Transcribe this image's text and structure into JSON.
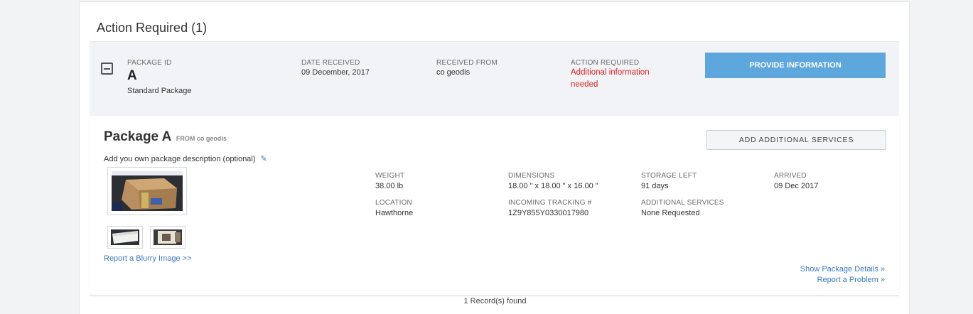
{
  "section": {
    "title": "Action Required (1)"
  },
  "summary": {
    "package_id_label": "PACKAGE ID",
    "package_id": "A",
    "package_type": "Standard Package",
    "date_received_label": "DATE RECEIVED",
    "date_received": "09 December, 2017",
    "received_from_label": "RECEIVED FROM",
    "received_from": "co geodis",
    "action_required_label": "ACTION REQUIRED",
    "action_required": "Additional information needed",
    "provide_button": "PROVIDE INFORMATION",
    "collapse_icon": "minus-square-icon"
  },
  "package": {
    "name": "Package A",
    "from_text": "FROM co geodis",
    "add_services_button": "ADD ADDITIONAL SERVICES",
    "description_prompt": "Add you own package description (optional)",
    "edit_icon": "pencil-icon",
    "pencil_glyph": "✎",
    "report_blurry": "Report a Blurry Image >>",
    "details": {
      "weight_label": "WEIGHT",
      "weight": "38.00 lb",
      "dimensions_label": "DIMENSIONS",
      "dimensions": "18.00 \" x 18.00 \" x 16.00 \"",
      "storage_label": "STORAGE LEFT",
      "storage": "91 days",
      "arrived_label": "ARRIVED",
      "arrived": "09 Dec 2017",
      "location_label": "LOCATION",
      "location": "Hawthorne",
      "tracking_label": "INCOMING TRACKING #",
      "tracking": "1Z9Y855Y0330017980",
      "additional_services_label": "ADDITIONAL SERVICES",
      "additional_services": "None Requested"
    },
    "show_details": "Show Package Details »",
    "report_problem": "Report a Problem »"
  },
  "footer": {
    "records": "1 Record(s) found"
  },
  "colors": {
    "accent": "#5da7dc",
    "link": "#3b79c2",
    "alert": "#e02020",
    "summary_bg": "#f1f3f7"
  }
}
